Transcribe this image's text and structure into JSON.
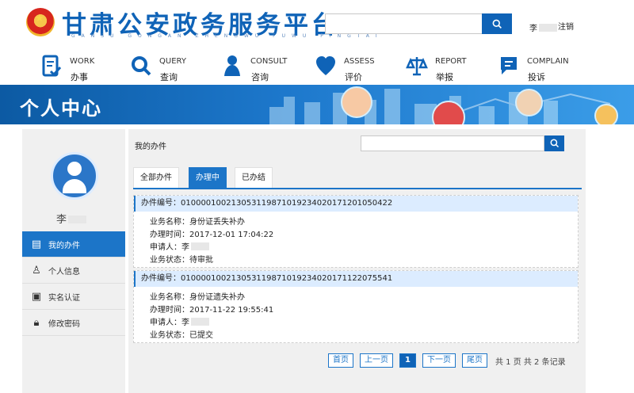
{
  "header": {
    "title": "甘肃公安政务服务平台",
    "pinyin": "GANSU GONGAN ZHENGWU FUWU PINGTAI",
    "user_prefix": "李",
    "logout": "注销"
  },
  "nav": [
    {
      "en": "WORK",
      "cn": "办事",
      "icon": "document-check-icon"
    },
    {
      "en": "QUERY",
      "cn": "查询",
      "icon": "magnifier-icon"
    },
    {
      "en": "CONSULT",
      "cn": "咨询",
      "icon": "person-icon"
    },
    {
      "en": "ASSESS",
      "cn": "评价",
      "icon": "heart-icon"
    },
    {
      "en": "REPORT",
      "cn": "举报",
      "icon": "scale-icon"
    },
    {
      "en": "COMPLAIN",
      "cn": "投诉",
      "icon": "message-icon"
    }
  ],
  "banner": {
    "title": "个人中心"
  },
  "sidebar": {
    "user_prefix": "李",
    "items": [
      {
        "label": "我的办件",
        "icon": "list-icon"
      },
      {
        "label": "个人信息",
        "icon": "user-icon"
      },
      {
        "label": "实名认证",
        "icon": "id-card-icon"
      },
      {
        "label": "修改密码",
        "icon": "lock-icon"
      }
    ]
  },
  "main": {
    "title": "我的办件",
    "tabs": [
      "全部办件",
      "办理中",
      "已办结"
    ],
    "records": [
      {
        "number_label": "办件编号：01000010021305311987101923402017120105042​2",
        "business": "业务名称：身份证丢失补办",
        "time": "办理时间：2017-12-01 17:04:22",
        "applicant": "申请人：李",
        "status": "业务状态：待审批"
      },
      {
        "number_label": "办件编号：010000100213053119871019234020171122075541",
        "business": "业务名称：身份证遗失补办",
        "time": "办理时间：2017-11-22 19:55:41",
        "applicant": "申请人：李",
        "status": "业务状态：已提交"
      }
    ],
    "pager": {
      "first": "首页",
      "prev": "上一页",
      "current": "1",
      "next": "下一页",
      "last": "尾页",
      "summary": "共 1 页  共 2 条记录"
    }
  },
  "colors": {
    "primary": "#0F63B7",
    "accent": "#1C75C8"
  }
}
